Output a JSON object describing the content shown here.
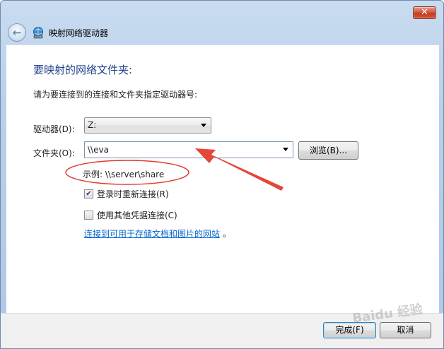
{
  "window": {
    "title": "映射网络驱动器",
    "close_glyph": "✕"
  },
  "dialog": {
    "heading": "要映射的网络文件夹:",
    "instruction": "请为要连接到的连接和文件夹指定驱动器号:",
    "drive": {
      "label": "驱动器(D):",
      "value": "Z:"
    },
    "folder": {
      "label": "文件夹(O):",
      "value": "\\\\eva",
      "browse_label": "浏览(B)..."
    },
    "example": "示例: \\\\server\\share",
    "reconnect": {
      "label": "登录时重新连接(R)",
      "checked": true
    },
    "other_credentials": {
      "label": "使用其他凭据连接(C)",
      "checked": false
    },
    "link": "连接到可用于存储文档和图片的网站",
    "link_suffix": "。"
  },
  "footer": {
    "finish_label": "完成(F)",
    "cancel_label": "取消"
  },
  "watermark": "Baidu 经验",
  "colors": {
    "heading": "#1f3f8c",
    "link": "#0066cc",
    "annotation": "#e03a2f"
  }
}
